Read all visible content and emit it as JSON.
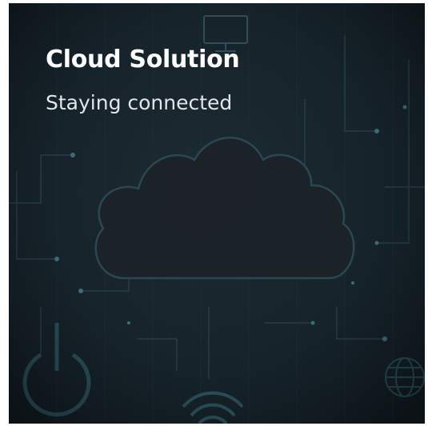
{
  "card": {
    "title": "Cloud Solution",
    "subtitle": "Staying connected"
  },
  "colors": {
    "background": "#162229",
    "accent_lines": "#2a4a55",
    "cloud_fill": "#1c2228",
    "title_text": "#ffffff",
    "subtitle_text": "#e2e6e8"
  },
  "icons": [
    "cloud-icon",
    "monitor-icon",
    "power-icon",
    "wifi-icon",
    "globe-icon"
  ]
}
